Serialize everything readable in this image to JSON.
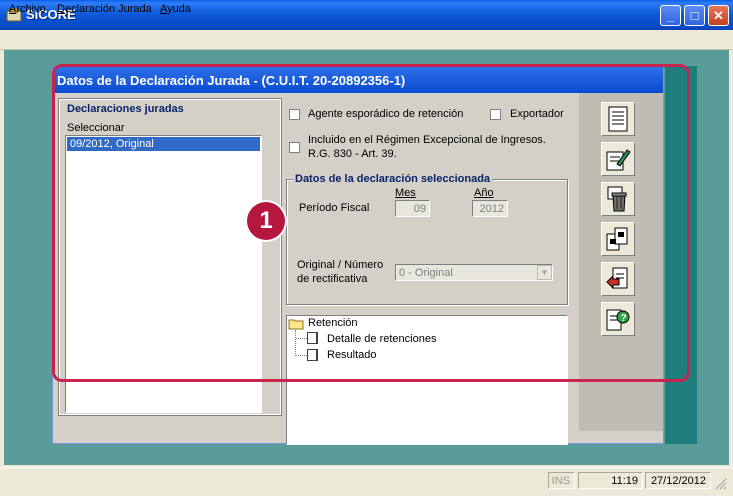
{
  "window": {
    "title": "SICORE",
    "controls": {
      "minimize": "_",
      "maximize": "□",
      "close": "✕"
    }
  },
  "menu": {
    "items": [
      {
        "label_u": "A",
        "label_rest": "rchivo"
      },
      {
        "label_u": "D",
        "label_rest": "eclaración Jurada"
      },
      {
        "label_u": "A",
        "label_rest": "yuda"
      }
    ]
  },
  "child": {
    "title": "Datos de la Declaración Jurada - (C.U.I.T. 20-20892356-1)"
  },
  "declaraciones": {
    "group_title": "Declaraciones juradas",
    "select_label": "Seleccionar",
    "items": [
      "09/2012, Original"
    ]
  },
  "options": {
    "agente_esporadico": "Agente esporádico de retención",
    "exportador": "Exportador",
    "regimen_line1": "Incluido en el Régimen Excepcional de Ingresos.",
    "regimen_line2": "R.G. 830 - Art. 39."
  },
  "datos": {
    "group_title": "Datos de la declaración seleccionada",
    "mes_label": "Mes",
    "anio_label": "Año",
    "periodo_label": "Período Fiscal",
    "mes_value": "09",
    "anio_value": "2012",
    "original_label_1": "Original / Número",
    "original_label_2": "de rectificativa",
    "original_value": "0 - Original"
  },
  "tree": {
    "root": "Retención",
    "children": [
      "Detalle de retenciones",
      "Resultado"
    ]
  },
  "status": {
    "ins": "INS",
    "time": "11:19",
    "date": "27/12/2012"
  },
  "annotation": {
    "step": "1"
  },
  "icons": {
    "app": "sicore-app-icon",
    "toolbar": [
      "document-list-icon",
      "edit-document-icon",
      "delete-trash-icon",
      "copy-documents-icon",
      "export-document-icon",
      "help-document-icon"
    ]
  },
  "colors": {
    "titlebar": "#0B57D8",
    "selection": "#316AC5",
    "highlight": "#C8244E",
    "workspace": "#5A9C9A"
  }
}
